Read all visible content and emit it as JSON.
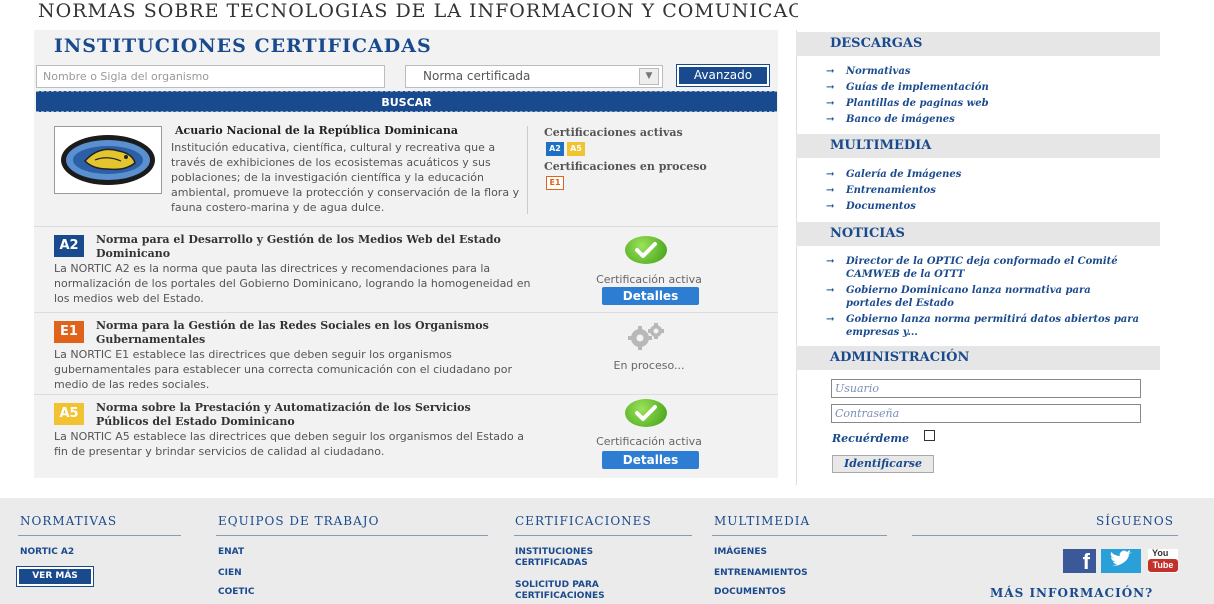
{
  "site": {
    "title": "NORMAS SOBRE TECNOLOGIAS DE LA INFORMACION Y COMUNICACION - NORTIC"
  },
  "main": {
    "title": "INSTITUCIONES CERTIFICADAS",
    "search_placeholder": "Nombre o Sigla del organismo",
    "select_value": "Norma certificada",
    "advanced_label": "Avanzado",
    "search_label": "BUSCAR"
  },
  "institution": {
    "name": "Acuario Nacional de la República Dominicana",
    "description": "Institución educativa, científica, cultural y recreativa que a través de exhibiciones de los ecosistemas acuáticos y sus poblaciones; de la investigación científica y la educación ambiental, promueve la protección y conservación de la flora y fauna costero-marina y de agua dulce.",
    "active_label": "Certificaciones activas",
    "active_badges": [
      "A2",
      "A5"
    ],
    "process_label": "Certificaciones en proceso",
    "process_badges": [
      "E1"
    ]
  },
  "norms": [
    {
      "code": "A2",
      "title": "Norma para el Desarrollo y Gestión de los Medios Web del Estado Dominicano",
      "description": "La NORTIC A2 es la norma que pauta las directrices y recomendaciones para la normalización de los portales del Gobierno Dominicano, logrando la homogeneidad en los medios web del Estado.",
      "status": "Certificación activa",
      "button": "Detalles"
    },
    {
      "code": "E1",
      "title": "Norma para la Gestión de las Redes Sociales en los Organismos Gubernamentales",
      "description": "La NORTIC E1 establece las directrices que deben seguir los organismos gubernamentales para establecer una correcta comunicación con el ciudadano por medio de las redes sociales.",
      "status": "En proceso..."
    },
    {
      "code": "A5",
      "title": "Norma sobre la Prestación y Automatización de los Servicios Públicos del Estado Dominicano",
      "description": "La NORTIC A5 establece las directrices que deben seguir los organismos del Estado a fin de presentar y brindar servicios de calidad al ciudadano.",
      "status": "Certificación activa",
      "button": "Detalles"
    }
  ],
  "sidebar": {
    "descargas": {
      "title": "DESCARGAS",
      "items": [
        "Normativas",
        "Guías de implementación",
        "Plantillas de paginas web",
        "Banco de imágenes"
      ]
    },
    "multimedia": {
      "title": "MULTIMEDIA",
      "items": [
        "Galería de Imágenes",
        "Entrenamientos",
        "Documentos"
      ]
    },
    "noticias": {
      "title": "NOTICIAS",
      "items": [
        "Director de la OPTIC deja conformado el Comité CAMWEB de la OTTT",
        "Gobierno Dominicano lanza normativa para portales del Estado",
        "Gobierno lanza norma permitirá datos abiertos para empresas y..."
      ]
    },
    "admin": {
      "title": "ADMINISTRACIÓN",
      "user_placeholder": "Usuario",
      "password_placeholder": "Contraseña",
      "remember_label": "Recuérdeme",
      "login_button": "Identificarse"
    },
    "arrow": "→"
  },
  "footer": {
    "normativas": {
      "title": "NORMATIVAS",
      "link": "NORTIC A2",
      "more": "VER MÁS"
    },
    "equipos": {
      "title": "EQUIPOS DE TRABAJO",
      "links": [
        "ENAT",
        "CIEN",
        "COETIC"
      ]
    },
    "certificaciones": {
      "title": "CERTIFICACIONES",
      "links": [
        "INSTITUCIONES CERTIFICADAS",
        "SOLICITUD PARA CERTIFICACIONES"
      ]
    },
    "multimedia": {
      "title": "MULTIMEDIA",
      "links": [
        "IMÁGENES",
        "ENTRENAMIENTOS",
        "DOCUMENTOS"
      ]
    },
    "siguenos": {
      "title": "SÍGUENOS",
      "facebook": "f",
      "youtube_top": "You",
      "youtube_bottom": "Tube"
    },
    "more_info": "MÁS INFORMACIÓN?"
  },
  "colors": {
    "brand_blue": "#1a4a8e",
    "accent_orange": "#e0631c",
    "accent_yellow": "#f1c232",
    "button_blue": "#2d7dd2",
    "check_green": "#3d9d12"
  }
}
